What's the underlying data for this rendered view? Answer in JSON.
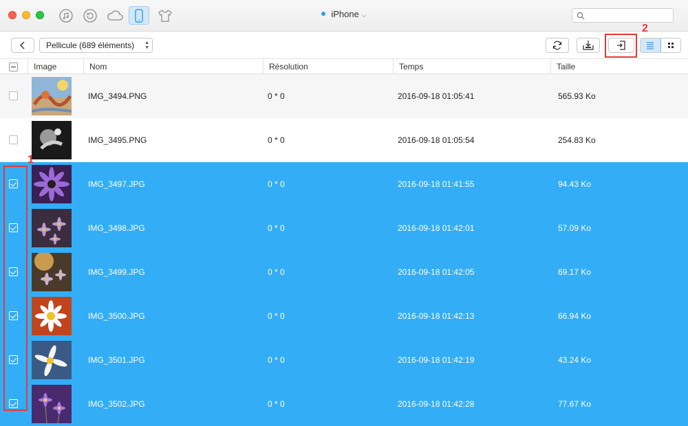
{
  "window": {
    "device_label": "iPhone",
    "search": {
      "placeholder": "",
      "value": ""
    },
    "nav_icons": [
      "music-icon",
      "history-icon",
      "cloud-icon",
      "iphone-icon",
      "tshirt-icon"
    ],
    "active_nav": "iphone-icon"
  },
  "toolbar": {
    "album_label": "Pellicule (689 éléments)",
    "callout_1": "1",
    "callout_2": "2"
  },
  "table": {
    "columns": [
      "Image",
      "Nom",
      "Résolution",
      "Temps",
      "Taille"
    ],
    "rows": [
      {
        "thumb": "thumb-painting",
        "name": "IMG_3494.PNG",
        "resolution": "0 * 0",
        "time": "2016-09-18 01:05:41",
        "size": "565.93 Ko",
        "checked": false
      },
      {
        "thumb": "thumb-bw",
        "name": "IMG_3495.PNG",
        "resolution": "0 * 0",
        "time": "2016-09-18 01:05:54",
        "size": "254.83 Ko",
        "checked": false
      },
      {
        "thumb": "thumb-purple-flower",
        "name": "IMG_3497.JPG",
        "resolution": "0 * 0",
        "time": "2016-09-18 01:41:55",
        "size": "94.43 Ko",
        "checked": true
      },
      {
        "thumb": "thumb-daisies-dark",
        "name": "IMG_3498.JPG",
        "resolution": "0 * 0",
        "time": "2016-09-18 01:42:01",
        "size": "57.09 Ko",
        "checked": true
      },
      {
        "thumb": "thumb-daisies-sun",
        "name": "IMG_3499.JPG",
        "resolution": "0 * 0",
        "time": "2016-09-18 01:42:05",
        "size": "69.17 Ko",
        "checked": true
      },
      {
        "thumb": "thumb-white-daisy",
        "name": "IMG_3500.JPG",
        "resolution": "0 * 0",
        "time": "2016-09-18 01:42:13",
        "size": "66.94 Ko",
        "checked": true
      },
      {
        "thumb": "thumb-white-daisy-blue",
        "name": "IMG_3501.JPG",
        "resolution": "0 * 0",
        "time": "2016-09-18 01:42:19",
        "size": "43.24 Ko",
        "checked": true
      },
      {
        "thumb": "thumb-purple-field",
        "name": "IMG_3502.JPG",
        "resolution": "0 * 0",
        "time": "2016-09-18 01:42:28",
        "size": "77.67 Ko",
        "checked": true
      }
    ]
  },
  "colors": {
    "selection": "#33adf5",
    "accent": "#2a9ff0",
    "highlight": "#e53935"
  }
}
